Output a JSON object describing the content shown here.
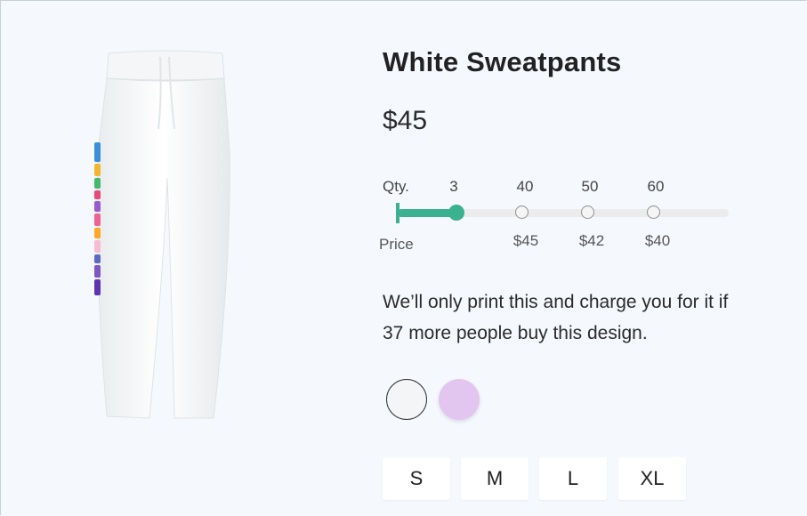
{
  "product": {
    "title": "White Sweatpants",
    "price": "$45",
    "image_icon": "sweatpants-image"
  },
  "pricing": {
    "qty_label": "Qty.",
    "price_label": "Price",
    "current_qty": "3",
    "tiers": [
      {
        "qty": "40",
        "price": "$45"
      },
      {
        "qty": "50",
        "price": "$42"
      },
      {
        "qty": "60",
        "price": "$40"
      }
    ],
    "accent_color": "#3cb18f"
  },
  "description": "We’ll only print this and charge you for it if 37 more people buy this design.",
  "colors": [
    {
      "name": "white",
      "hex": "#f3f5f7",
      "selected": true
    },
    {
      "name": "lilac",
      "hex": "#e2c6ef",
      "selected": false
    }
  ],
  "sizes": [
    "S",
    "M",
    "L",
    "XL"
  ]
}
